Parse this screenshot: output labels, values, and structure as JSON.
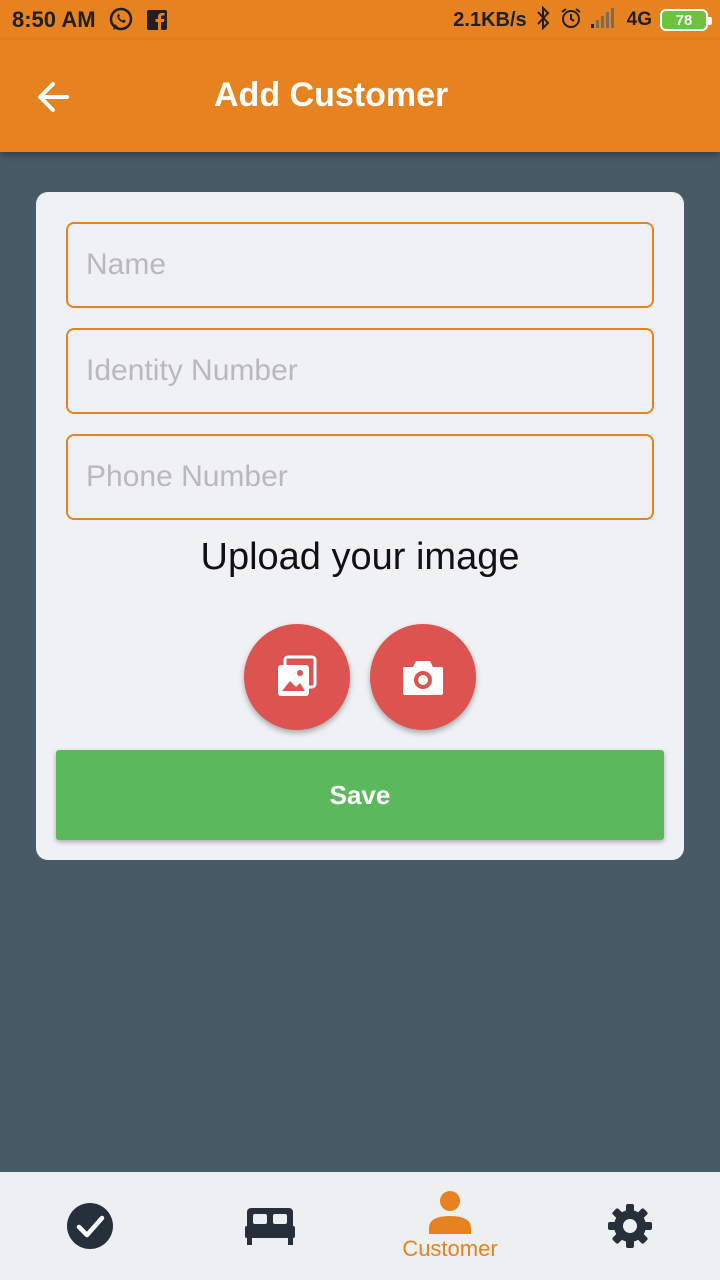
{
  "status_bar": {
    "time": "8:50 AM",
    "left_icons": [
      "whatsapp-icon",
      "facebook-icon"
    ],
    "network_speed": "2.1KB/s",
    "network_type": "4G",
    "battery": "78",
    "right_icons": [
      "bluetooth-icon",
      "alarm-icon",
      "signal-icon"
    ]
  },
  "app_bar": {
    "title": "Add Customer",
    "back_icon": "arrow-left-icon"
  },
  "form": {
    "name_placeholder": "Name",
    "name_value": "",
    "identity_placeholder": "Identity Number",
    "identity_value": "",
    "phone_placeholder": "Phone Number",
    "phone_value": "",
    "upload_title": "Upload your image",
    "gallery_icon": "gallery-icon",
    "camera_icon": "camera-icon",
    "save_label": "Save"
  },
  "bottom_nav": {
    "items": [
      {
        "icon": "check-circle-icon",
        "label": ""
      },
      {
        "icon": "bed-icon",
        "label": ""
      },
      {
        "icon": "person-icon",
        "label": "Customer",
        "active": true
      },
      {
        "icon": "gear-icon",
        "label": ""
      }
    ]
  },
  "colors": {
    "accent": "#e6821f",
    "background": "#475a66",
    "card": "#f0f1f5",
    "fab": "#dc5350",
    "save": "#5cb85c",
    "nav_icon": "#26303b"
  }
}
